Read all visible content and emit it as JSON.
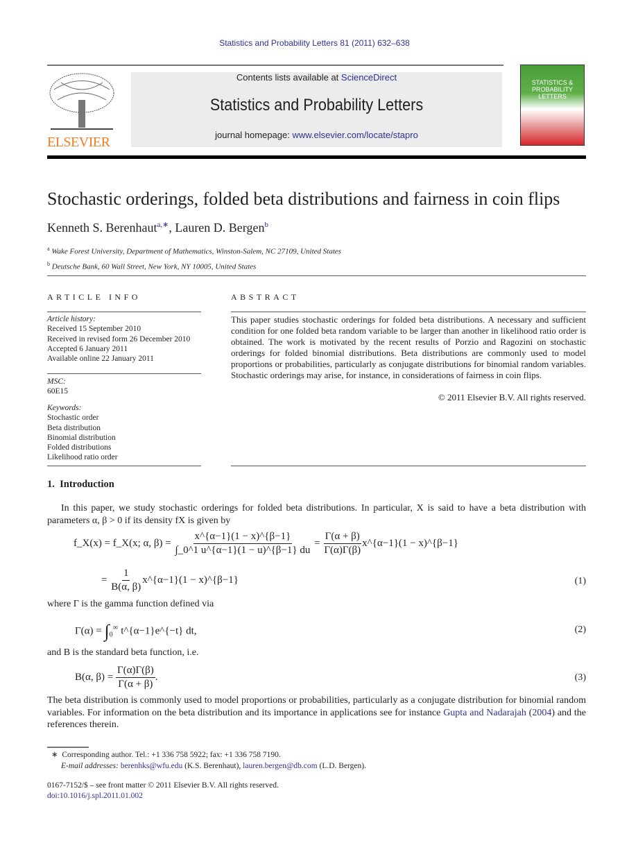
{
  "running_header": "Statistics and Probability Letters 81 (2011) 632–638",
  "masthead": {
    "publisher_logo": "ELSEVIER",
    "contents_prefix": "Contents lists available at ",
    "contents_link": "ScienceDirect",
    "journal_title": "Statistics and Probability Letters",
    "homepage_prefix": "journal homepage: ",
    "homepage_link": "www.elsevier.com/locate/stapro",
    "cover_text": "STATISTICS & PROBABILITY LETTERS"
  },
  "article": {
    "title": "Stochastic orderings, folded beta distributions and fairness in coin flips",
    "authors": [
      {
        "name": "Kenneth S. Berenhaut",
        "sup": "a,∗"
      },
      {
        "name": "Lauren D. Bergen",
        "sup": "b"
      }
    ],
    "affiliations": [
      {
        "mark": "a",
        "text": "Wake Forest University, Department of Mathematics, Winston-Salem, NC 27109, United States"
      },
      {
        "mark": "b",
        "text": "Deutsche Bank, 60 Wall Street, New York, NY 10005, United States"
      }
    ]
  },
  "article_info": {
    "heading": "ARTICLE INFO",
    "history_label": "Article history:",
    "history": [
      "Received 15 September 2010",
      "Received in revised form 26 December 2010",
      "Accepted 6 January 2011",
      "Available online 22 January 2011"
    ],
    "msc_label": "MSC:",
    "msc": "60E15",
    "keywords_label": "Keywords:",
    "keywords": [
      "Stochastic order",
      "Beta distribution",
      "Binomial distribution",
      "Folded distributions",
      "Likelihood ratio order"
    ]
  },
  "abstract": {
    "heading": "ABSTRACT",
    "text": "This paper studies stochastic orderings for folded beta distributions. A necessary and sufficient condition for one folded beta random variable to be larger than another in likelihood ratio order is obtained. The work is motivated by the recent results of Porzio and Ragozini on stochastic orderings for folded binomial distributions. Beta distributions are commonly used to model proportions or probabilities, particularly as conjugate distributions for binomial random variables. Stochastic orderings may arise, for instance, in considerations of fairness in coin flips.",
    "copyright": "© 2011 Elsevier B.V. All rights reserved."
  },
  "section": {
    "heading": "1.  Introduction",
    "para1": "In this paper, we study stochastic orderings for folded beta distributions. In particular, X is said to have a beta distribution with parameters α, β > 0 if its density fX is given by",
    "where1": "where Γ is the gamma function defined via",
    "where2": "and B is the standard beta function, i.e.",
    "para2_text": "The beta distribution is commonly used to model proportions or probabilities, particularly as a conjugate distribution for binomial random variables. For information on the beta distribution and its importance in applications see for instance ",
    "para2_link1": "Gupta and Nadarajah",
    "para2_link2": "2004",
    "para2_end": ") and the references therein."
  },
  "equations": {
    "eq1a_lhs": "f_X(x) = f_X(x; α, β) =",
    "eq1a_num": "x^{α−1}(1 − x)^{β−1}",
    "eq1a_den": "∫_0^1 u^{α−1}(1 − u)^{β−1} du",
    "eq1a_num2": "Γ(α + β)",
    "eq1a_den2": "Γ(α)Γ(β)",
    "eq1a_tail": "x^{α−1}(1 − x)^{β−1}",
    "eq1b_num": "1",
    "eq1b_den": "B(α, β)",
    "eq1_no": "(1)",
    "eq2_lhs": "Γ(α) =",
    "eq2_body": "t^{α−1}e^{−t} dt,",
    "eq2_no": "(2)",
    "eq3_lhs": "B(α, β) =",
    "eq3_num": "Γ(α)Γ(β)",
    "eq3_den": "Γ(α + β)",
    "eq3_no": "(3)"
  },
  "footnotes": {
    "star": "∗",
    "corresponding": "Corresponding author. Tel.: +1 336 758 5922; fax: +1 336 758 7190.",
    "email_label": "E-mail addresses:",
    "email1": "berenhks@wfu.edu",
    "email1_who": " (K.S. Berenhaut), ",
    "email2": "lauren.bergen@db.com",
    "email2_who": " (L.D. Bergen).",
    "front_matter": "0167-7152/$ – see front matter © 2011 Elsevier B.V. All rights reserved.",
    "doi": "doi:10.1016/j.spl.2011.01.002"
  },
  "colors": {
    "link": "#2e3192",
    "elsevier_orange": "#f47b20",
    "masthead_gray": "#ececec"
  }
}
